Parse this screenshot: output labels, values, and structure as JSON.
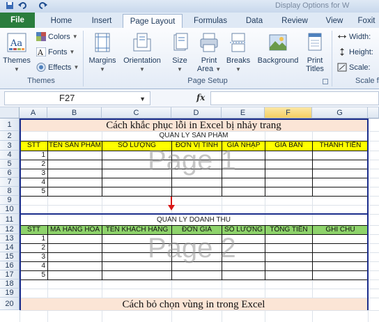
{
  "window": {
    "doc_title": "Display Options for W",
    "partial_tab": "Foxit"
  },
  "tabs": [
    {
      "label": "File"
    },
    {
      "label": "Home"
    },
    {
      "label": "Insert"
    },
    {
      "label": "Page Layout"
    },
    {
      "label": "Formulas"
    },
    {
      "label": "Data"
    },
    {
      "label": "Review"
    },
    {
      "label": "View"
    },
    {
      "label": "Foxit"
    }
  ],
  "ribbon": {
    "themes": {
      "themes_label": "Themes",
      "colors_label": "Colors",
      "fonts_label": "Fonts",
      "effects_label": "Effects",
      "group_label": "Themes"
    },
    "page_setup": {
      "margins_label": "Margins",
      "orientation_label": "Orientation",
      "size_label": "Size",
      "print_area_label": [
        "Print",
        "Area"
      ],
      "breaks_label": "Breaks",
      "background_label": "Background",
      "print_titles_label": [
        "Print",
        "Titles"
      ],
      "group_label": "Page Setup"
    },
    "scale": {
      "width_label": "Width:",
      "height_label": "Height:",
      "scale_label": "Scale:",
      "group_label": "Scale fo"
    }
  },
  "formula_bar": {
    "name_box": "F27",
    "fx_symbol": "fx",
    "formula": ""
  },
  "columns": [
    "A",
    "B",
    "C",
    "D",
    "E",
    "F",
    "G"
  ],
  "selected_column": "F",
  "rows": [
    "1",
    "2",
    "3",
    "4",
    "5",
    "6",
    "7",
    "8",
    "9",
    "10",
    "11",
    "12",
    "13",
    "14",
    "15",
    "16",
    "17",
    "18",
    "19",
    "20"
  ],
  "sheet": {
    "title1": "Cách khắc phục lỗi in Excel bị nhảy trang",
    "section1_title": "QUẢN LÝ SẢN PHẨM",
    "headers1": [
      "STT",
      "TÊN SẢN PHẨM",
      "SỐ LƯỢNG",
      "ĐƠN VỊ TÍNH",
      "GIÁ NHẬP",
      "GIÁ BÁN",
      "THÀNH TIỀN"
    ],
    "section2_title": "QUẢN LÝ DOANH THU",
    "headers2": [
      "STT",
      "MÃ HÀNG HÓA",
      "TÊN KHÁCH HÀNG",
      "ĐƠN GIÁ",
      "SỐ LƯỢNG",
      "TỔNG TIỀN",
      "GHI CHÚ"
    ],
    "stt1": [
      "1",
      "2",
      "3",
      "4",
      "5"
    ],
    "stt2": [
      "1",
      "2",
      "3",
      "4",
      "5"
    ],
    "watermark1": "Page 1",
    "watermark2": "Page 2",
    "title2": "Cách bỏ chọn vùng in trong Excel"
  },
  "colors": {
    "file_tab": "#2a7d3d",
    "yellow_header": "#ffff00",
    "green_header": "#8ed36b",
    "title_band": "#fbe5d6",
    "page_border": "#1c2e8c",
    "arrow": "#d81818"
  }
}
